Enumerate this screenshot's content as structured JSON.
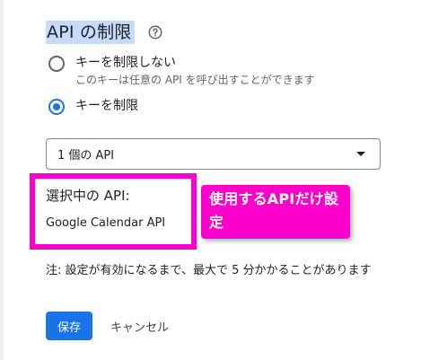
{
  "section": {
    "heading": "API の制限",
    "help_icon": "help-circle-icon"
  },
  "restriction_options": [
    {
      "label": "キーを制限しない",
      "description": "このキーは任意の API を呼び出すことができます",
      "checked": false
    },
    {
      "label": "キーを制限",
      "checked": true
    }
  ],
  "api_select": {
    "value": "1 個の API",
    "icon": "dropdown-arrow-icon"
  },
  "selected_apis": {
    "title": "選択中の API:",
    "items": [
      "Google Calendar API"
    ]
  },
  "annotation": {
    "text": "使用するAPIだけ設定",
    "color": "#ff00cc"
  },
  "note": "注: 設定が有効になるまで、最大で 5 分かかることがあります",
  "buttons": {
    "save": "保存",
    "cancel": "キャンセル"
  },
  "colors": {
    "accent": "#1a73e8",
    "highlight": "#ff00cc",
    "heading_bg": "#c6dafc"
  }
}
